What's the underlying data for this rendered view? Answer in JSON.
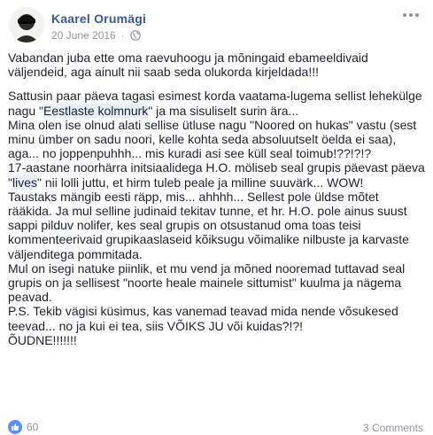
{
  "post": {
    "author": "Kaarel Orumägi",
    "date": "20 June 2016",
    "separator": "·",
    "privacy_icon": "globe-icon",
    "menu_icon": "more-icon",
    "lead": "Vabandan juba ette oma raevuhoogu ja mõningaid ebameeldivaid väljendeid, aga ainult nii saab seda olukorda kirjeldada!!!",
    "lines": {
      "l1a": "Sattusin paar päeva tagasi esimest korda vaatama-lugema sellist lehekülge nagu \"",
      "l1_highlight": "Eestlaste kolmnurk",
      "l1b": "\" ja ma sisuliselt surin ära...",
      "l2": "Mina olen ise olnud alati sellise ütluse nagu \"Noored on hukas\" vastu (sest minu ümber on sadu noori, kelle kohta seda absoluutselt öelda ei saa), aga... no joppenpuhhh... mis kuradi asi see küll seal toimub!??!?!?",
      "l3a": "17-aastane noorhärra initsiaalidega H.O. möliseb seal grupis päevast päeva \"",
      "l3_highlight": "lives",
      "l3b": "\" nii lolli juttu, et hirm tuleb peale ja milline suuvärk... WOW!",
      "l4": "Taustaks mängib eesti räpp, mis... ahhhh... Sellest pole üldse mõtet rääkida. Ja mul selline judinaid tekitav tunne, et hr. H.O. pole ainus suust sappi pilduv nolifer, kes seal grupis on otsustanud oma toas teisi kommenteerivaid grupikaaslaseid kõiksugu võimalike nilbuste ja karvaste väljenditega pommitada.",
      "l5": "Mul on isegi natuke piinlik, et mu vend ja mõned nooremad tuttavad seal grupis on ja sellisest \"noorte heale mainele sittumist\" kuulma ja nägema peavad.",
      "l6": "P.S. Tekib vägisi küsimus, kas vanemad teavad mida nende võsukesed teevad... no ja kui ei tea, siis VÕIKS JU või kuidas?!?!",
      "l7": "ÕUDNE!!!!!!!"
    }
  },
  "footer": {
    "like_icon": "thumbs-up-icon",
    "reaction_count": "60",
    "comments": "3 Comments"
  }
}
